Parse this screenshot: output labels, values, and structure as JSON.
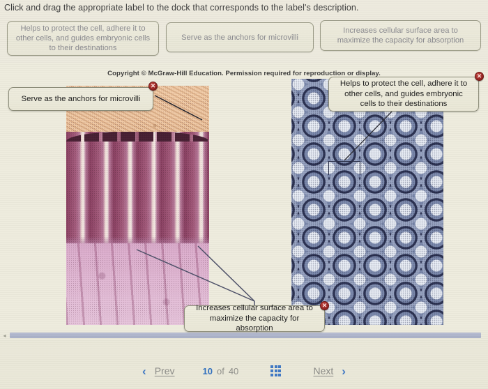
{
  "instruction": "Click and drag the appropriate label to the dock that corresponds to the label's description.",
  "copyright": "Copyright © McGraw-Hill Education. Permission required for reproduction or display.",
  "label_bank": {
    "items": [
      {
        "text": "Helps to protect the cell, adhere it to other cells, and guides embryonic cells to their destinations"
      },
      {
        "text": "Serve as the anchors for microvilli"
      },
      {
        "text": "Increases cellular surface area to maximize the capacity for absorption"
      }
    ]
  },
  "placed_labels": [
    {
      "text": "Serve as the anchors for microvilli",
      "close": "✕"
    },
    {
      "text": "Helps to protect the cell, adhere it to other cells, and guides embryonic cells to their destinations",
      "close": "✕"
    },
    {
      "text": "Increases cellular surface area to maximize the capacity for absorption",
      "close": "✕"
    }
  ],
  "figure": {
    "left_panel_name": "longitudinal-section-microvilli-micrograph",
    "right_panel_name": "cross-section-microvilli-micrograph"
  },
  "scrollbar": {
    "left_arrow": "◂"
  },
  "nav": {
    "prev_chevron": "‹",
    "prev_label": "Prev",
    "current_page": "10",
    "of_label": "of",
    "total_pages": "40",
    "grid_icon": "grid-icon",
    "next_label": "Next",
    "next_chevron": "›"
  },
  "colors": {
    "page_bg": "#eceadc",
    "accent_blue": "#3f78c4",
    "muted_text": "#8a8a8f",
    "close_red": "#8d1e1c",
    "scrollbar_thumb": "#adb4cb"
  }
}
